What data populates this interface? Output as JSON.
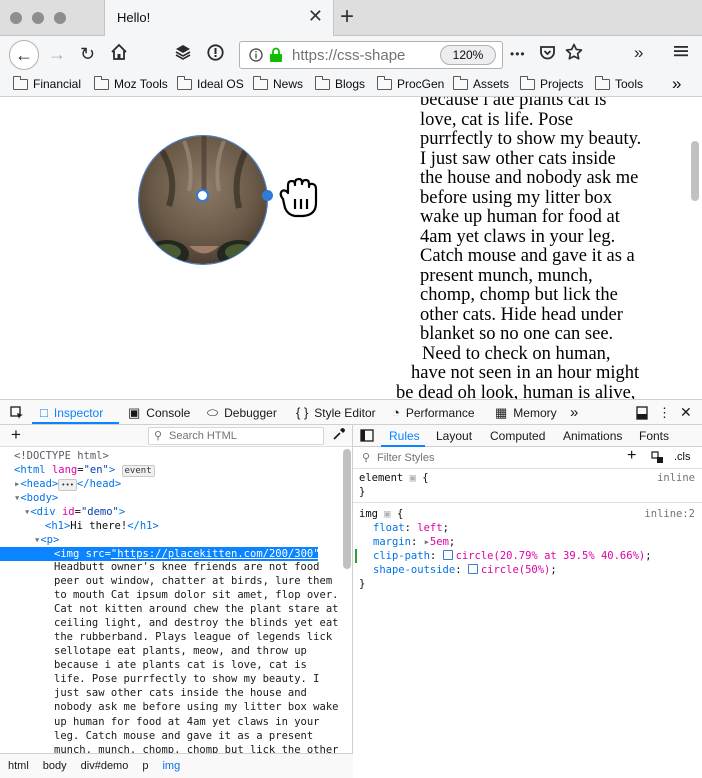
{
  "window": {
    "tab_title": "Hello!",
    "tab_close": "✕",
    "new_tab": "+"
  },
  "nav": {
    "url": "https://css-shape",
    "zoom": "120%",
    "more": "•••"
  },
  "bookmarks": [
    "Financial",
    "Moz Tools",
    "Ideal OS",
    "News",
    "Blogs",
    "ProcGen",
    "Assets",
    "Projects",
    "Tools"
  ],
  "page": {
    "text_lines": [
      "because i ate plants cat is",
      "love, cat is life. Pose",
      "purrfectly to show my beauty.",
      "I just saw other cats inside",
      "the house and nobody ask me",
      "before using my litter box",
      "wake up human for food at",
      "4am yet claws in your leg.",
      "Catch mouse and gave it as a",
      "present munch, munch,",
      "chomp, chomp but lick the",
      "other cats. Hide head under",
      "blanket so no one can see.",
      "Need to check on human,",
      "have not seen in an hour might",
      "be dead oh look, human is alive,"
    ]
  },
  "devtools": {
    "tabs": [
      "Inspector",
      "Console",
      "Debugger",
      "Style Editor",
      "Performance",
      "Memory"
    ],
    "search_placeholder": "Search HTML",
    "tree": {
      "doctype": "<!DOCTYPE html>",
      "html_open": "<html",
      "html_attr": "lang",
      "html_val": "\"en\"",
      "html_close": ">",
      "event_badge": "event",
      "head": "<head>",
      "head_end": "</head>",
      "ellipsis": "•••",
      "body": "<body>",
      "div_open": "<div",
      "div_attr": "id",
      "div_val": "\"demo\"",
      "h1_open": "<h1>",
      "h1_text": "Hi there!",
      "h1_close": "</h1>",
      "p": "<p>",
      "img_open": "<img",
      "img_attr": "src",
      "img_val": "\"https://placekitten.com/200/300\"",
      "img_close": ">"
    },
    "text_content": "Headbutt owner's knee friends are not food peer out window, chatter at birds, lure them to mouth Cat ipsum dolor sit amet, flop over. Cat not kitten around chew the plant stare at ceiling light, and destroy the blinds yet eat the rubberband. Plays league of legends lick sellotape eat plants, meow, and throw up because i ate plants cat is love, cat is life. Pose purrfectly to show my beauty. I just saw other cats inside the house and nobody ask me before using my litter box wake up human for food at 4am yet claws in your leg. Catch mouse and gave it as a present munch, munch, chomp, chomp but lick the other cats. Hide head under",
    "breadcrumb": [
      "html",
      "body",
      "div#demo",
      "p",
      "img"
    ],
    "rules_tabs": [
      "Rules",
      "Layout",
      "Computed",
      "Animations",
      "Fonts"
    ],
    "filter_placeholder": "Filter Styles",
    "cls": ".cls",
    "rules": {
      "element_selector": "element",
      "element_source": "inline",
      "img_selector": "img",
      "img_source": "inline:2",
      "open_brace": "{",
      "close_brace": "}",
      "props": [
        {
          "name": "float",
          "value": "left"
        },
        {
          "name": "margin",
          "value": "5em"
        },
        {
          "name": "clip-path",
          "value": "circle(20.79% at 39.5% 40.66%)"
        },
        {
          "name": "shape-outside",
          "value": "circle(50%)"
        }
      ]
    }
  },
  "colors": {
    "accent": "#0a84ff",
    "tag": "#0074e8",
    "attr": "#dd00a9"
  }
}
